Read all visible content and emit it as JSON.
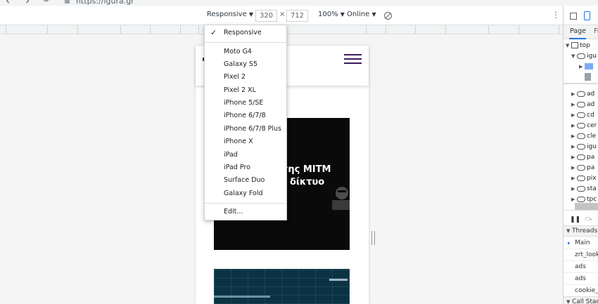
{
  "browser": {
    "url": "https://igura.gr"
  },
  "toolbar": {
    "device_label": "Responsive",
    "width_value": "320",
    "times": "×",
    "height_value": "712",
    "zoom_label": "100%",
    "network_label": "Online"
  },
  "menu": {
    "checked": "Responsive",
    "devices": [
      "Moto G4",
      "Galaxy S5",
      "Pixel 2",
      "Pixel 2 XL",
      "iPhone 5/SE",
      "iPhone 6/7/8",
      "iPhone 6/7/8 Plus",
      "iPhone X",
      "iPad",
      "iPad Pro",
      "Surface Duo",
      "Galaxy Fold"
    ],
    "edit": "Edit..."
  },
  "page": {
    "card1_line1": "εσης MITM",
    "card1_line2": "δίκτυο"
  },
  "devtools": {
    "tab_page": "Page",
    "tab_other": "Fi",
    "top_label": "top",
    "frames": [
      "igu",
      "",
      "",
      "ad",
      "ad",
      "cd",
      "cer",
      "cle",
      "igu",
      "pa",
      "pa",
      "pix",
      "sta",
      "tpc"
    ],
    "threads_label": "Threads",
    "threads": [
      "Main",
      "zrt_looku",
      "ads",
      "ads",
      "cookie_p"
    ],
    "callstack_label": "Call Stac"
  }
}
